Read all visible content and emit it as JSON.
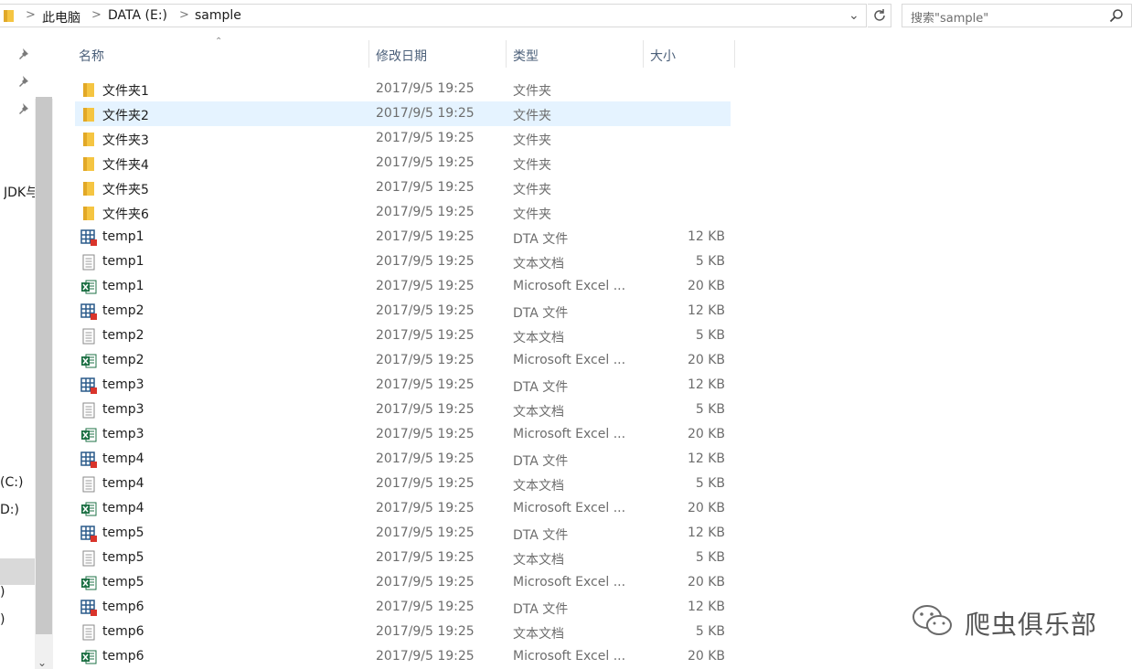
{
  "address_bar": {
    "crumbs": [
      "此电脑",
      "DATA (E:)",
      "sample"
    ]
  },
  "search": {
    "placeholder": "搜索\"sample\""
  },
  "nav_pane": {
    "items": [
      "JDK与",
      "(C:)",
      "D:)",
      ")",
      ")"
    ]
  },
  "columns": {
    "name": "名称",
    "date": "修改日期",
    "type": "类型",
    "size": "大小"
  },
  "files": [
    {
      "name": "文件夹1",
      "date": "2017/9/5 19:25",
      "type": "文件夹",
      "size": "",
      "icon": "folder-icon"
    },
    {
      "name": "文件夹2",
      "date": "2017/9/5 19:25",
      "type": "文件夹",
      "size": "",
      "icon": "folder-icon",
      "selected": true
    },
    {
      "name": "文件夹3",
      "date": "2017/9/5 19:25",
      "type": "文件夹",
      "size": "",
      "icon": "folder-icon"
    },
    {
      "name": "文件夹4",
      "date": "2017/9/5 19:25",
      "type": "文件夹",
      "size": "",
      "icon": "folder-icon"
    },
    {
      "name": "文件夹5",
      "date": "2017/9/5 19:25",
      "type": "文件夹",
      "size": "",
      "icon": "folder-icon"
    },
    {
      "name": "文件夹6",
      "date": "2017/9/5 19:25",
      "type": "文件夹",
      "size": "",
      "icon": "folder-icon"
    },
    {
      "name": "temp1",
      "date": "2017/9/5 19:25",
      "type": "DTA 文件",
      "size": "12 KB",
      "icon": "dta-file-icon"
    },
    {
      "name": "temp1",
      "date": "2017/9/5 19:25",
      "type": "文本文档",
      "size": "5 KB",
      "icon": "text-file-icon"
    },
    {
      "name": "temp1",
      "date": "2017/9/5 19:25",
      "type": "Microsoft Excel ...",
      "size": "20 KB",
      "icon": "excel-file-icon"
    },
    {
      "name": "temp2",
      "date": "2017/9/5 19:25",
      "type": "DTA 文件",
      "size": "12 KB",
      "icon": "dta-file-icon"
    },
    {
      "name": "temp2",
      "date": "2017/9/5 19:25",
      "type": "文本文档",
      "size": "5 KB",
      "icon": "text-file-icon"
    },
    {
      "name": "temp2",
      "date": "2017/9/5 19:25",
      "type": "Microsoft Excel ...",
      "size": "20 KB",
      "icon": "excel-file-icon"
    },
    {
      "name": "temp3",
      "date": "2017/9/5 19:25",
      "type": "DTA 文件",
      "size": "12 KB",
      "icon": "dta-file-icon"
    },
    {
      "name": "temp3",
      "date": "2017/9/5 19:25",
      "type": "文本文档",
      "size": "5 KB",
      "icon": "text-file-icon"
    },
    {
      "name": "temp3",
      "date": "2017/9/5 19:25",
      "type": "Microsoft Excel ...",
      "size": "20 KB",
      "icon": "excel-file-icon"
    },
    {
      "name": "temp4",
      "date": "2017/9/5 19:25",
      "type": "DTA 文件",
      "size": "12 KB",
      "icon": "dta-file-icon"
    },
    {
      "name": "temp4",
      "date": "2017/9/5 19:25",
      "type": "文本文档",
      "size": "5 KB",
      "icon": "text-file-icon"
    },
    {
      "name": "temp4",
      "date": "2017/9/5 19:25",
      "type": "Microsoft Excel ...",
      "size": "20 KB",
      "icon": "excel-file-icon"
    },
    {
      "name": "temp5",
      "date": "2017/9/5 19:25",
      "type": "DTA 文件",
      "size": "12 KB",
      "icon": "dta-file-icon"
    },
    {
      "name": "temp5",
      "date": "2017/9/5 19:25",
      "type": "文本文档",
      "size": "5 KB",
      "icon": "text-file-icon"
    },
    {
      "name": "temp5",
      "date": "2017/9/5 19:25",
      "type": "Microsoft Excel ...",
      "size": "20 KB",
      "icon": "excel-file-icon"
    },
    {
      "name": "temp6",
      "date": "2017/9/5 19:25",
      "type": "DTA 文件",
      "size": "12 KB",
      "icon": "dta-file-icon"
    },
    {
      "name": "temp6",
      "date": "2017/9/5 19:25",
      "type": "文本文档",
      "size": "5 KB",
      "icon": "text-file-icon"
    },
    {
      "name": "temp6",
      "date": "2017/9/5 19:25",
      "type": "Microsoft Excel ...",
      "size": "20 KB",
      "icon": "excel-file-icon"
    }
  ],
  "watermark": {
    "text": "爬虫俱乐部",
    "icon": "wechat-icon"
  },
  "colors": {
    "selection": "#e5f3ff",
    "header_text": "#4c607a",
    "folder": "#f5c542",
    "excel": "#1e7145",
    "dta": "#2a5a8a"
  }
}
